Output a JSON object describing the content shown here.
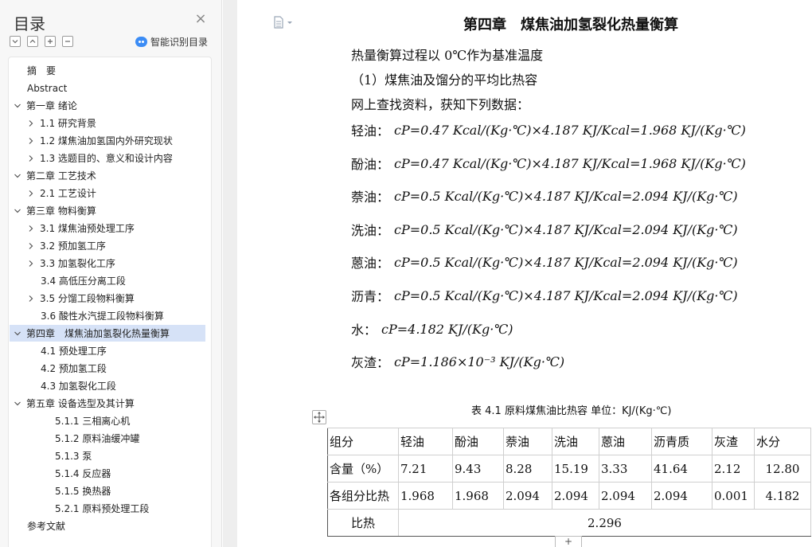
{
  "sidebar": {
    "title": "目录",
    "smart_toc_label": "智能识别目录",
    "items": [
      {
        "label": "摘　要",
        "level": 1,
        "has_children": false,
        "expanded": false,
        "selected": false
      },
      {
        "label": "Abstract",
        "level": 1,
        "has_children": false,
        "expanded": false,
        "selected": false
      },
      {
        "label": "第一章 绪论",
        "level": 1,
        "has_children": true,
        "expanded": true,
        "selected": false
      },
      {
        "label": "1.1 研究背景",
        "level": 2,
        "has_children": true,
        "expanded": false,
        "selected": false
      },
      {
        "label": "1.2 煤焦油加氢国内外研究现状",
        "level": 2,
        "has_children": true,
        "expanded": false,
        "selected": false
      },
      {
        "label": "1.3 选题目的、意义和设计内容",
        "level": 2,
        "has_children": true,
        "expanded": false,
        "selected": false
      },
      {
        "label": "第二章 工艺技术",
        "level": 1,
        "has_children": true,
        "expanded": true,
        "selected": false
      },
      {
        "label": "2.1 工艺设计",
        "level": 2,
        "has_children": true,
        "expanded": false,
        "selected": false
      },
      {
        "label": "第三章 物料衡算",
        "level": 1,
        "has_children": true,
        "expanded": true,
        "selected": false
      },
      {
        "label": "3.1 煤焦油预处理工序",
        "level": 2,
        "has_children": true,
        "expanded": false,
        "selected": false
      },
      {
        "label": "3.2 预加氢工序",
        "level": 2,
        "has_children": true,
        "expanded": false,
        "selected": false
      },
      {
        "label": "3.3 加氢裂化工序",
        "level": 2,
        "has_children": true,
        "expanded": false,
        "selected": false
      },
      {
        "label": "3.4 高低压分离工段",
        "level": 2,
        "has_children": false,
        "expanded": false,
        "selected": false
      },
      {
        "label": "3.5 分馏工段物料衡算",
        "level": 2,
        "has_children": true,
        "expanded": false,
        "selected": false
      },
      {
        "label": "3.6 酸性水汽提工段物料衡算",
        "level": 2,
        "has_children": false,
        "expanded": false,
        "selected": false
      },
      {
        "label": "第四章　煤焦油加氢裂化热量衡算",
        "level": 1,
        "has_children": true,
        "expanded": true,
        "selected": true
      },
      {
        "label": "4.1 预处理工序",
        "level": 2,
        "has_children": false,
        "expanded": false,
        "selected": false
      },
      {
        "label": "4.2 预加氢工段",
        "level": 2,
        "has_children": false,
        "expanded": false,
        "selected": false
      },
      {
        "label": "4.3 加氢裂化工段",
        "level": 2,
        "has_children": false,
        "expanded": false,
        "selected": false
      },
      {
        "label": "第五章 设备选型及其计算",
        "level": 1,
        "has_children": true,
        "expanded": true,
        "selected": false
      },
      {
        "label": "5.1.1 三相离心机",
        "level": 3,
        "has_children": false,
        "expanded": false,
        "selected": false
      },
      {
        "label": "5.1.2 原料油缓冲罐",
        "level": 3,
        "has_children": false,
        "expanded": false,
        "selected": false
      },
      {
        "label": "5.1.3 泵",
        "level": 3,
        "has_children": false,
        "expanded": false,
        "selected": false
      },
      {
        "label": "5.1.4 反应器",
        "level": 3,
        "has_children": false,
        "expanded": false,
        "selected": false
      },
      {
        "label": "5.1.5 换热器",
        "level": 3,
        "has_children": false,
        "expanded": false,
        "selected": false
      },
      {
        "label": "5.2.1 原料预处理工段",
        "level": 3,
        "has_children": false,
        "expanded": false,
        "selected": false
      },
      {
        "label": "参考文献",
        "level": 1,
        "has_children": false,
        "expanded": false,
        "selected": false
      }
    ]
  },
  "document": {
    "chapter_title": "第四章　煤焦油加氢裂化热量衡算",
    "intro_lines": [
      "热量衡算过程以 0℃作为基准温度",
      "（1）煤焦油及馏分的平均比热容",
      "网上查找资料，获知下列数据："
    ],
    "formulas": [
      {
        "label": "轻油：",
        "expr": "cP=0.47 Kcal/(Kg·℃)×4.187 KJ/Kcal=1.968 KJ/(Kg·℃)"
      },
      {
        "label": "酚油：",
        "expr": "cP=0.47 Kcal/(Kg·℃)×4.187 KJ/Kcal=1.968 KJ/(Kg·℃)"
      },
      {
        "label": "萘油：",
        "expr": "cP=0.5 Kcal/(Kg·℃)×4.187 KJ/Kcal=2.094 KJ/(Kg·℃)"
      },
      {
        "label": "洗油：",
        "expr": "cP=0.5 Kcal/(Kg·℃)×4.187 KJ/Kcal=2.094 KJ/(Kg·℃)"
      },
      {
        "label": "蒽油：",
        "expr": "cP=0.5 Kcal/(Kg·℃)×4.187 KJ/Kcal=2.094 KJ/(Kg·℃)"
      },
      {
        "label": "沥青：",
        "expr": "cP=0.5 Kcal/(Kg·℃)×4.187 KJ/Kcal=2.094 KJ/(Kg·℃)"
      },
      {
        "label": "水：",
        "expr": "cP=4.182 KJ/(Kg·℃)"
      },
      {
        "label": "灰渣：",
        "expr": "cP=1.186×10⁻³ KJ/(Kg·℃)"
      }
    ],
    "table": {
      "caption": "表 4.1 原料煤焦油比热容 单位：KJ/(Kg·℃)",
      "header": [
        "组分",
        "轻油",
        "酚油",
        "萘油",
        "洗油",
        "蒽油",
        "沥青质",
        "灰渣",
        "水分"
      ],
      "rows": [
        [
          "含量（%）",
          "7.21",
          "9.43",
          "8.28",
          "15.19",
          "3.33",
          "41.64",
          "2.12",
          "12.80"
        ],
        [
          "各组分比热",
          "1.968",
          "1.968",
          "2.094",
          "2.094",
          "2.094",
          "2.094",
          "0.001",
          "4.182"
        ]
      ],
      "footer": {
        "label": "比热",
        "value": "2.296"
      },
      "add_symbol": "+"
    }
  }
}
